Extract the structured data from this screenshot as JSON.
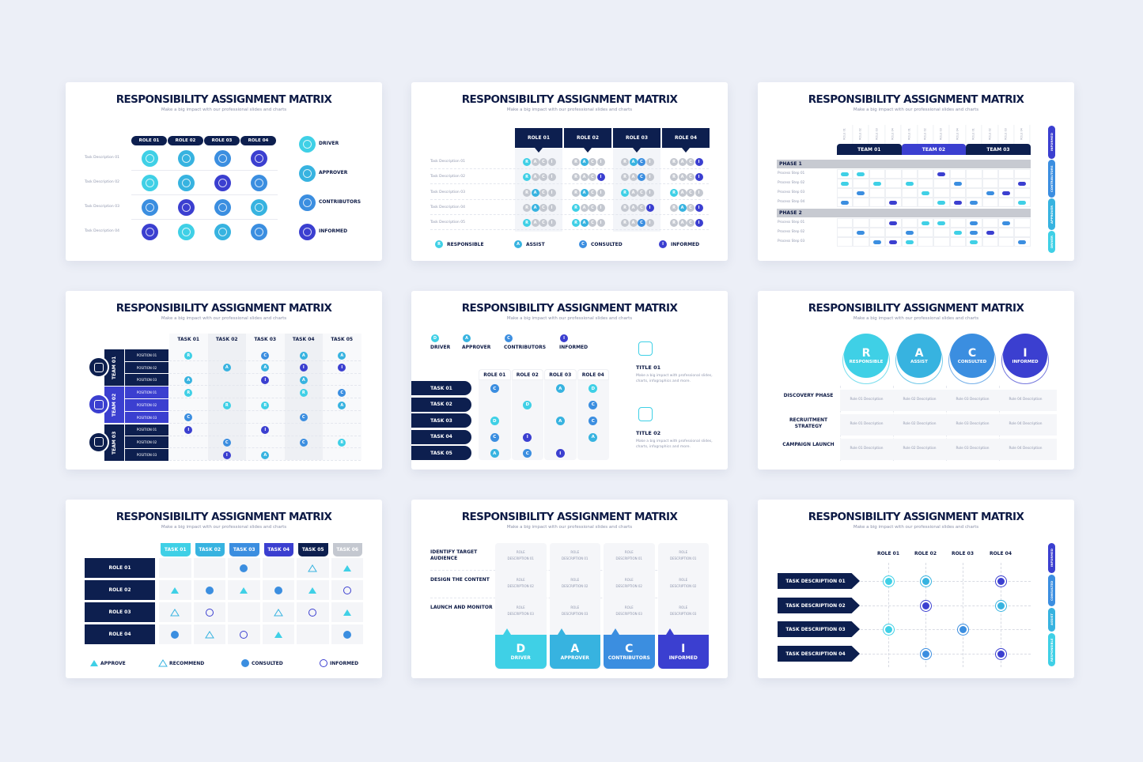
{
  "common": {
    "title": "RESPONSIBILITY ASSIGNMENT MATRIX",
    "subtitle": "Make a big impact with our professional slides and charts"
  },
  "colors": {
    "navy": "#0d1f4f",
    "responsible": "#3fd0e6",
    "assist": "#37b3e0",
    "consulted": "#3b8ee0",
    "informed": "#3b3fd0",
    "gray": "#c4c8d0",
    "background": "#eceff7"
  },
  "slide1": {
    "roles": [
      "ROLE 01",
      "ROLE 02",
      "ROLE 03",
      "ROLE 04"
    ],
    "tasks": [
      "Task Description 01",
      "Task Description 02",
      "Task Description 03",
      "Task Description 04"
    ],
    "matrix": [
      [
        "driver",
        "approver",
        "contributors",
        "informed"
      ],
      [
        "driver",
        "approver",
        "informed",
        "contributors"
      ],
      [
        "contributors",
        "informed",
        "contributors",
        "approver"
      ],
      [
        "informed",
        "driver",
        "approver",
        "contributors"
      ]
    ],
    "legend": [
      {
        "key": "driver",
        "label": "DRIVER",
        "icon": "target-person-icon"
      },
      {
        "key": "approver",
        "label": "APPROVER",
        "icon": "flag-person-icon"
      },
      {
        "key": "contributors",
        "label": "CONTRIBUTORS",
        "icon": "group-icon"
      },
      {
        "key": "informed",
        "label": "INFORMED",
        "icon": "chat-people-icon"
      }
    ]
  },
  "slide2": {
    "roles": [
      "ROLE 01",
      "ROLE 02",
      "ROLE 03",
      "ROLE 04"
    ],
    "tasks": [
      "Task Description 01",
      "Task Description 02",
      "Task Description 03",
      "Task Description 04",
      "Task Description 05"
    ],
    "letters": [
      "R",
      "A",
      "C",
      "I"
    ],
    "matrix": [
      [
        "R",
        "A",
        "AC",
        "I"
      ],
      [
        "R",
        "I",
        "C",
        "I"
      ],
      [
        "A",
        "A",
        "R",
        "R"
      ],
      [
        "A",
        "R",
        "I",
        "AI"
      ],
      [
        "R",
        "RA",
        "C",
        "I"
      ]
    ],
    "legend": [
      {
        "letter": "R",
        "label": "RESPONSIBLE"
      },
      {
        "letter": "A",
        "label": "ASSIST"
      },
      {
        "letter": "C",
        "label": "CONSULTED"
      },
      {
        "letter": "I",
        "label": "INFORMED"
      }
    ]
  },
  "slide3": {
    "role_labels": [
      "ROLE 01",
      "ROLE 02",
      "ROLE 03",
      "ROLE 04",
      "ROLE 01",
      "ROLE 02",
      "ROLE 03",
      "ROLE 04",
      "ROLE 01",
      "ROLE 02",
      "ROLE 03",
      "ROLE 04"
    ],
    "teams": [
      "TEAM 01",
      "TEAM 02",
      "TEAM 03"
    ],
    "phases": [
      {
        "name": "PHASE 1",
        "steps": [
          "Process Step 01",
          "Process Step 02",
          "Process Step 03",
          "Process Step 04"
        ],
        "cells": [
          [
            "d",
            "r",
            null,
            null,
            null,
            null,
            "i",
            null,
            null,
            null,
            null,
            null
          ],
          [
            "d",
            null,
            "r",
            null,
            "r",
            null,
            null,
            "c",
            null,
            null,
            null,
            "i"
          ],
          [
            null,
            "c",
            null,
            null,
            null,
            "r",
            null,
            null,
            null,
            "c",
            "i",
            null
          ],
          [
            "c",
            null,
            null,
            "i",
            null,
            null,
            "r",
            "i",
            "c",
            null,
            null,
            "r"
          ]
        ]
      },
      {
        "name": "PHASE 2",
        "steps": [
          "Process Step 01",
          "Process Step 02",
          "Process Step 03"
        ],
        "cells": [
          [
            null,
            null,
            null,
            "i",
            null,
            "r",
            "d",
            null,
            "c",
            null,
            "c",
            null
          ],
          [
            null,
            "c",
            null,
            null,
            "c",
            null,
            null,
            "r",
            "c",
            "i",
            null,
            null
          ],
          [
            null,
            null,
            "c",
            "i",
            "r",
            null,
            null,
            null,
            "r",
            null,
            null,
            "c"
          ]
        ]
      }
    ],
    "side_legend": [
      "INFORMED",
      "CONTRIBUTORS",
      "APPROVER",
      "DRIVER"
    ]
  },
  "slide4": {
    "tasks": [
      "TASK 01",
      "TASK 02",
      "TASK 03",
      "TASK 04",
      "TASK 05"
    ],
    "teams": [
      {
        "name": "TEAM 01",
        "icon": "desk-worker-icon",
        "positions": [
          "POSITION 01",
          "POSITION 02",
          "POSITION 03"
        ]
      },
      {
        "name": "TEAM 02",
        "icon": "meeting-icon",
        "positions": [
          "POSITION 01",
          "POSITION 02",
          "POSITION 03"
        ]
      },
      {
        "name": "TEAM 03",
        "icon": "globe-icon",
        "positions": [
          "POSITION 01",
          "POSITION 02",
          "POSITION 03"
        ]
      }
    ],
    "matrix": [
      [
        "R",
        "",
        "C",
        "A",
        "A"
      ],
      [
        "",
        "A",
        "A",
        "I",
        "I"
      ],
      [
        "A",
        "",
        "I",
        "A",
        ""
      ],
      [
        "R",
        "",
        "",
        "R",
        "C"
      ],
      [
        "",
        "R",
        "R",
        "",
        "A"
      ],
      [
        "C",
        "",
        "",
        "C",
        ""
      ],
      [
        "I",
        "",
        "I",
        "",
        ""
      ],
      [
        "",
        "C",
        "",
        "C",
        "R"
      ],
      [
        "",
        "I",
        "A",
        "",
        ""
      ]
    ]
  },
  "slide5": {
    "legend": [
      {
        "letter": "D",
        "label": "DRIVER"
      },
      {
        "letter": "A",
        "label": "APPROVER"
      },
      {
        "letter": "C",
        "label": "CONTRIBUTORS"
      },
      {
        "letter": "I",
        "label": "INFORMED"
      }
    ],
    "roles": [
      "ROLE 01",
      "ROLE 02",
      "ROLE 03",
      "ROLE 04"
    ],
    "tasks": [
      "TASK 01",
      "TASK 02",
      "TASK 03",
      "TASK 04",
      "TASK 05"
    ],
    "matrix": [
      [
        "C",
        "",
        "A",
        "D"
      ],
      [
        "",
        "D",
        "",
        "C"
      ],
      [
        "D",
        "",
        "A",
        "C"
      ],
      [
        "C",
        "I",
        "",
        "A"
      ],
      [
        "A",
        "C",
        "I",
        ""
      ]
    ],
    "info": [
      {
        "title": "TITLE 01",
        "text": "Make a big impact with professional slides, charts, infographics and more.",
        "icon": "hierarchy-people-icon"
      },
      {
        "title": "TITLE 02",
        "text": "Make a big impact with professional slides, charts, infographics and more.",
        "icon": "presentation-people-icon"
      }
    ]
  },
  "slide6": {
    "headers": [
      {
        "letter": "R",
        "label": "RESPONSIBLE"
      },
      {
        "letter": "A",
        "label": "ASSIST"
      },
      {
        "letter": "C",
        "label": "CONSULTED"
      },
      {
        "letter": "I",
        "label": "INFORMED"
      }
    ],
    "rows": [
      {
        "label": "DISCOVERY PHASE",
        "cells": [
          "Role 01 Description",
          "Role 02 Description",
          "Role 03 Description",
          "Role 04 Description"
        ]
      },
      {
        "label": "RECRUITMENT STRATEGY",
        "cells": [
          "Role 01 Description",
          "Role 02 Description",
          "Role 03 Description",
          "Role 04 Description"
        ]
      },
      {
        "label": "CAMPAIGN LAUNCH",
        "cells": [
          "Role 01 Description",
          "Role 02 Description",
          "Role 03 Description",
          "Role 04 Description"
        ]
      }
    ]
  },
  "slide7": {
    "tasks": [
      "TASK 01",
      "TASK 02",
      "TASK 03",
      "TASK 04",
      "TASK 05",
      "TASK 06"
    ],
    "task_colors": [
      "#3fd0e6",
      "#37b3e0",
      "#3b8ee0",
      "#3b3fd0",
      "#0d1f4f",
      "#c4c8d0"
    ],
    "roles": [
      "ROLE 01",
      "ROLE 02",
      "ROLE 03",
      "ROLE 04"
    ],
    "matrix": [
      [
        "",
        "",
        "C",
        "",
        "R",
        "A"
      ],
      [
        "A",
        "C",
        "A",
        "C",
        "A",
        "I"
      ],
      [
        "R",
        "I",
        "",
        "R",
        "I",
        "A"
      ],
      [
        "C",
        "R",
        "I",
        "A",
        "",
        "C"
      ]
    ],
    "legend": [
      {
        "key": "A",
        "label": "APPROVE"
      },
      {
        "key": "R",
        "label": "RECOMMEND"
      },
      {
        "key": "C",
        "label": "CONSULTED"
      },
      {
        "key": "I",
        "label": "INFORMED"
      }
    ]
  },
  "slide8": {
    "rows": [
      "IDENTIFY TARGET AUDIENCE",
      "DESIGN THE CONTENT",
      "LAUNCH AND MONITOR"
    ],
    "cell_line1": "ROLE",
    "cell_line2": [
      "DESCRIPTION 01",
      "DESCRIPTION 02",
      "DESCRIPTION 03"
    ],
    "footers": [
      {
        "letter": "D",
        "label": "DRIVER"
      },
      {
        "letter": "A",
        "label": "APPROVER"
      },
      {
        "letter": "C",
        "label": "CONTRIBUTORS"
      },
      {
        "letter": "I",
        "label": "INFORMED"
      }
    ]
  },
  "slide9": {
    "roles": [
      "ROLE 01",
      "ROLE 02",
      "ROLE 03",
      "ROLE 04"
    ],
    "tasks": [
      "TASK DESCRIPTION 01",
      "TASK DESCRIPTION 02",
      "TASK DESCRIPTION 03",
      "TASK DESCRIPTION 04"
    ],
    "matrix": [
      [
        "r",
        "a",
        "",
        "i"
      ],
      [
        "",
        "i",
        "",
        "a"
      ],
      [
        "r",
        "",
        "c",
        ""
      ],
      [
        "",
        "c",
        "",
        "i"
      ]
    ],
    "side_legend": [
      "INFORMED",
      "CONSULTED",
      "ASSIST",
      "RESPONSIBLE"
    ]
  }
}
